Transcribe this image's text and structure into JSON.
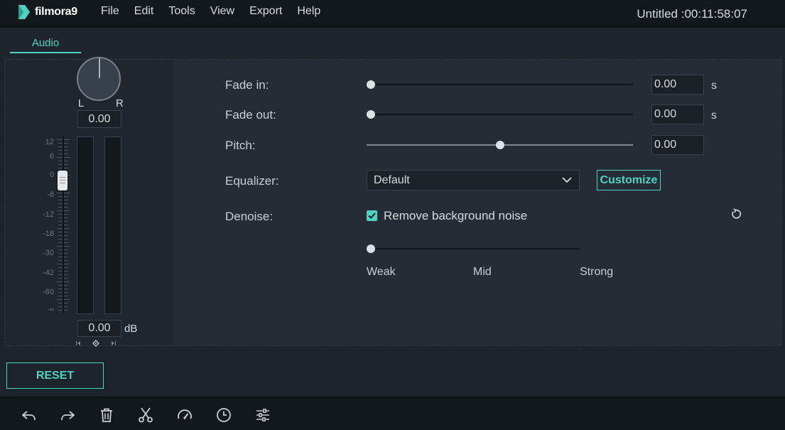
{
  "app": {
    "logo_text": "filmora9",
    "project_title": "Untitled :00:11:58:07"
  },
  "menu": [
    "File",
    "Edit",
    "Tools",
    "View",
    "Export",
    "Help"
  ],
  "tab": {
    "label": "Audio"
  },
  "pan": {
    "left_label": "L",
    "right_label": "R",
    "value": "0.00"
  },
  "volume": {
    "scale": [
      "12",
      "6",
      "0",
      "-6",
      "-12",
      "-18",
      "-30",
      "-42",
      "-60",
      "-∞"
    ],
    "value": "0.00",
    "unit": "dB"
  },
  "fade_in": {
    "label": "Fade in:",
    "value": "0.00",
    "unit": "s",
    "level": 0
  },
  "fade_out": {
    "label": "Fade out:",
    "value": "0.00",
    "unit": "s",
    "level": 0
  },
  "pitch": {
    "label": "Pitch:",
    "value": "0.00",
    "level": 0.5
  },
  "equalizer": {
    "label": "Equalizer:",
    "selected": "Default",
    "customize_label": "Customize"
  },
  "denoise": {
    "label": "Denoise:",
    "checkbox_label": "Remove background noise",
    "checked": true,
    "level": 0,
    "weak_label": "Weak",
    "mid_label": "Mid",
    "strong_label": "Strong"
  },
  "reset_label": "RESET",
  "toolbar": [
    "undo-icon",
    "redo-icon",
    "delete-icon",
    "cut-icon",
    "speed-icon",
    "duration-icon",
    "adjust-icon"
  ],
  "colors": {
    "accent": "#4cd3c2",
    "background": "#1d232a",
    "panel": "#252c35"
  }
}
